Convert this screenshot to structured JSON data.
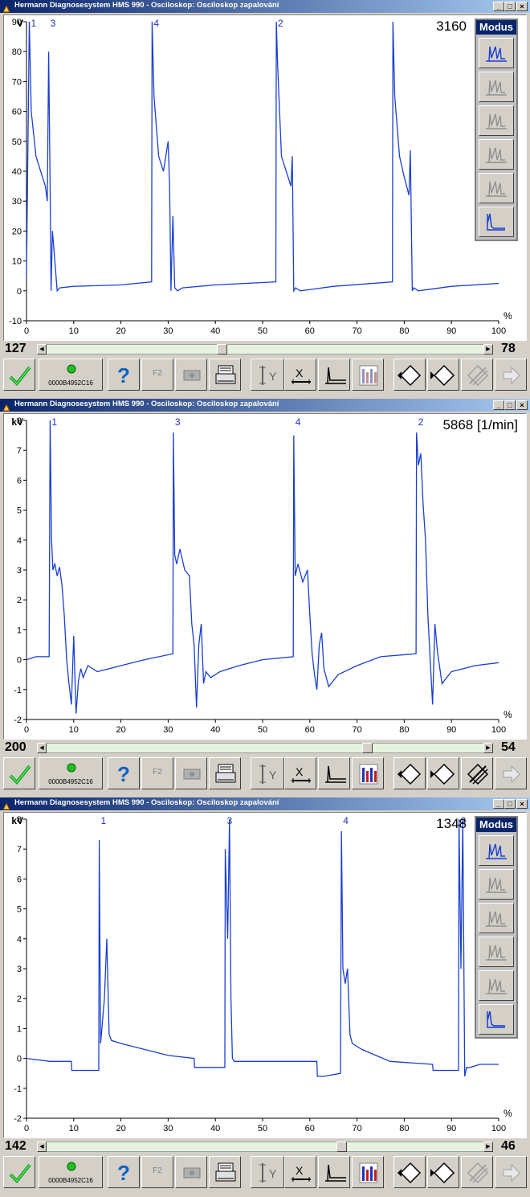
{
  "windows": [
    {
      "title": "Hermann Diagnosesystem HMS 990 - Osciloskop: Osciloskop zapalování",
      "unit": "V",
      "rpm": "3160",
      "show_modus": true,
      "modus_label": "Modus",
      "modus_selected": 5,
      "cylinder_labels": [
        "1",
        "3",
        "4",
        "2"
      ],
      "y_ticks": [
        "90",
        "80",
        "70",
        "60",
        "50",
        "40",
        "30",
        "20",
        "10",
        "0",
        "-10"
      ],
      "x_ticks": [
        "0",
        "10",
        "20",
        "30",
        "40",
        "50",
        "60",
        "70",
        "80",
        "90",
        "100"
      ],
      "x_unit": "%",
      "scroll_left": "127",
      "scroll_right": "78",
      "scroll_position": 0.4,
      "device_id": "0000B4952C16",
      "f2_label": "F2",
      "histogram_active": false,
      "toolbar_right_active": false,
      "chart_data": {
        "type": "line",
        "ylabel": "V",
        "xlabel": "%",
        "xlim": [
          0,
          100
        ],
        "ylim": [
          -10,
          90
        ],
        "series": [
          {
            "x": [
              0,
              0.6,
              1,
              2,
              3,
              4,
              4.4,
              4.7,
              5,
              5.2,
              5.5,
              6,
              6.5,
              7,
              10,
              20,
              26.5,
              26.6,
              27,
              28,
              29,
              30,
              30.3,
              30.6,
              31,
              31.4,
              32,
              33,
              40,
              52.8,
              52.9,
              53.2,
              54,
              55,
              56,
              56.3,
              56.6,
              57,
              58,
              65,
              77.5,
              77.6,
              78,
              79,
              80,
              81,
              81.3,
              81.7,
              82,
              83,
              90,
              100
            ],
            "y": [
              5,
              90,
              60,
              45,
              40,
              35,
              30,
              80,
              35,
              0,
              20,
              10,
              0,
              1,
              1.5,
              2,
              3,
              90,
              65,
              45,
              40,
              50,
              35,
              0,
              25,
              1,
              0,
              1,
              2,
              3,
              90,
              75,
              45,
              40,
              35,
              45,
              0,
              1,
              0,
              1.5,
              3,
              90,
              65,
              45,
              38,
              32,
              47,
              0,
              1,
              0,
              1.5,
              2.5
            ]
          }
        ]
      }
    },
    {
      "title": "Hermann Diagnosesystem HMS 990 - Osciloskop: Osciloskop zapalování",
      "unit": "kV",
      "rpm": "5868 [1/min]",
      "show_modus": false,
      "modus_label": "",
      "modus_selected": 0,
      "cylinder_labels": [
        "1",
        "3",
        "4",
        "2"
      ],
      "y_ticks": [
        "8",
        "7",
        "6",
        "5",
        "4",
        "3",
        "2",
        "1",
        "0",
        "-1",
        "-2"
      ],
      "x_ticks": [
        "0",
        "10",
        "20",
        "30",
        "40",
        "50",
        "60",
        "70",
        "80",
        "90",
        "100"
      ],
      "x_unit": "%",
      "scroll_left": "200",
      "scroll_right": "54",
      "scroll_position": 0.74,
      "device_id": "0000B4952C16",
      "f2_label": "F2",
      "histogram_active": true,
      "toolbar_right_active": true,
      "chart_data": {
        "type": "line",
        "ylabel": "kV",
        "xlabel": "%",
        "xlim": [
          0,
          100
        ],
        "ylim": [
          -2,
          8
        ],
        "series": [
          {
            "x": [
              0,
              2,
              4.8,
              5,
              5.3,
              5.6,
              6,
              6.5,
              7,
              7.5,
              8,
              8.5,
              9,
              9.5,
              10,
              10.5,
              11,
              11.5,
              12,
              13,
              15,
              20,
              25,
              31,
              31.1,
              31.4,
              31.8,
              32.5,
              33.5,
              34.5,
              35,
              35.5,
              36,
              36.5,
              37,
              37.5,
              38,
              39,
              41,
              45,
              50,
              56.5,
              56.6,
              56.9,
              57.5,
              58.5,
              59.5,
              60,
              60.5,
              61,
              61.5,
              62,
              62.5,
              63,
              64,
              66,
              70,
              75,
              82.5,
              82.6,
              83,
              83.5,
              84,
              84.5,
              85,
              85.5,
              86,
              86.5,
              87,
              88,
              89,
              90,
              95,
              100
            ],
            "y": [
              0,
              0.1,
              0.1,
              8,
              4,
              3,
              3.2,
              2.8,
              3.1,
              2.5,
              1.5,
              0,
              -0.8,
              -1.5,
              0.8,
              -1.8,
              -0.7,
              -0.3,
              -0.6,
              -0.2,
              -0.4,
              -0.2,
              0,
              0.2,
              7.6,
              3.5,
              3.2,
              3.7,
              3,
              2.8,
              1.2,
              0.5,
              -1.6,
              0.5,
              1.2,
              -0.8,
              -0.4,
              -0.6,
              -0.4,
              -0.2,
              0,
              0.1,
              7.5,
              2.8,
              3.2,
              2.6,
              3,
              1.5,
              0.2,
              -0.5,
              -1,
              0.5,
              0.9,
              -0.3,
              -0.9,
              -0.5,
              -0.2,
              0.1,
              0.2,
              7.6,
              6.5,
              6.9,
              5.2,
              4,
              1.5,
              0,
              -1.5,
              1.2,
              0.3,
              -0.8,
              -0.6,
              -0.4,
              -0.2,
              -0.1
            ]
          }
        ]
      }
    },
    {
      "title": "Hermann Diagnosesystem HMS 990 - Osciloskop: Osciloskop zapalování",
      "unit": "kV",
      "rpm": "1348",
      "show_modus": true,
      "modus_label": "Modus",
      "modus_selected": 5,
      "cylinder_labels": [
        "1",
        "3",
        "4",
        "2"
      ],
      "y_ticks": [
        "8",
        "7",
        "6",
        "5",
        "4",
        "3",
        "2",
        "1",
        "0",
        "-1",
        "-2"
      ],
      "x_ticks": [
        "0",
        "10",
        "20",
        "30",
        "40",
        "50",
        "60",
        "70",
        "80",
        "90",
        "100"
      ],
      "x_unit": "%",
      "scroll_left": "142",
      "scroll_right": "46",
      "scroll_position": 0.68,
      "device_id": "0000B4952C16",
      "f2_label": "F2",
      "histogram_active": true,
      "toolbar_right_active": false,
      "chart_data": {
        "type": "line",
        "ylabel": "kV",
        "xlabel": "%",
        "xlim": [
          0,
          100
        ],
        "ylim": [
          -2,
          8
        ],
        "series": [
          {
            "x": [
              0,
              5,
              9.5,
              9.6,
              12,
              15.3,
              15.4,
              15.7,
              16.5,
              17,
              17.5,
              18,
              20,
              30,
              35.5,
              35.6,
              38,
              42,
              42.1,
              42.6,
              43,
              43.3,
              43.6,
              44,
              45,
              55,
              61.5,
              61.6,
              63,
              66.5,
              66.7,
              67,
              67.5,
              68,
              68.5,
              69,
              71,
              77,
              86,
              86.1,
              88,
              91.5,
              91.6,
              92,
              92.4,
              92.8,
              93.2,
              94,
              96,
              100
            ],
            "y": [
              0,
              -0.1,
              -0.1,
              -0.4,
              -0.4,
              -0.4,
              7.3,
              0.5,
              2,
              4,
              0.8,
              0.6,
              0.5,
              0.1,
              0,
              -0.3,
              -0.3,
              -0.3,
              7,
              4,
              8,
              2,
              0,
              -0.1,
              -0.1,
              -0.1,
              -0.1,
              -0.6,
              -0.6,
              -0.5,
              7.6,
              3,
              2.5,
              3,
              0.8,
              0.5,
              0.3,
              -0.1,
              -0.2,
              -0.4,
              -0.4,
              -0.4,
              8,
              3,
              8,
              -0.6,
              -0.3,
              -0.3,
              -0.2,
              -0.2
            ]
          }
        ]
      }
    }
  ]
}
